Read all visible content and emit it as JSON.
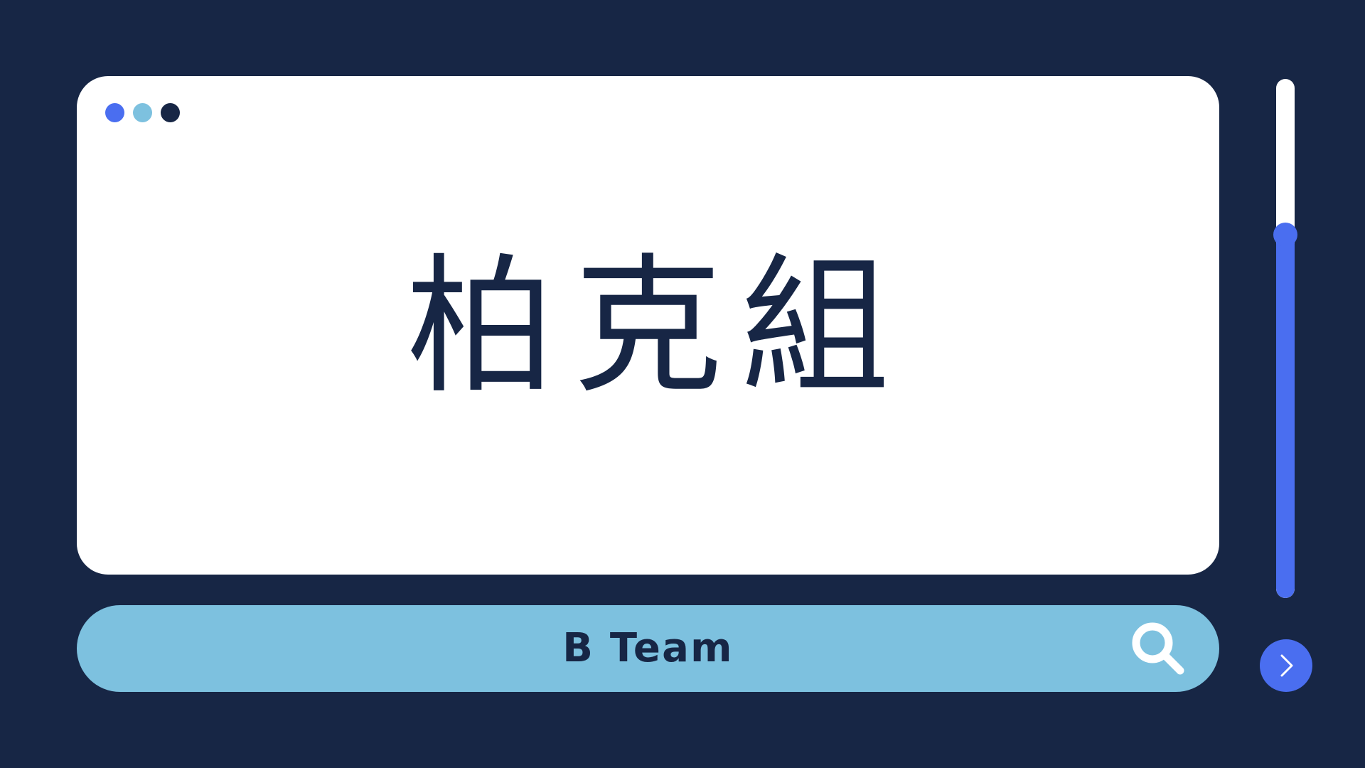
{
  "window": {
    "title": "柏克組",
    "dots": [
      {
        "name": "blue-dot",
        "color": "#4a6ef0"
      },
      {
        "name": "light-blue-dot",
        "color": "#7dc1df"
      },
      {
        "name": "navy-dot",
        "color": "#172645"
      }
    ]
  },
  "search": {
    "text": "B Team",
    "icon": "search-icon"
  },
  "scrollbar": {
    "position_fraction": 0.3
  },
  "next_button": {
    "icon": "chevron-right-icon"
  },
  "colors": {
    "background": "#172645",
    "panel": "#ffffff",
    "search_bar": "#7dc1df",
    "accent": "#4a6ef0",
    "text": "#172645"
  }
}
